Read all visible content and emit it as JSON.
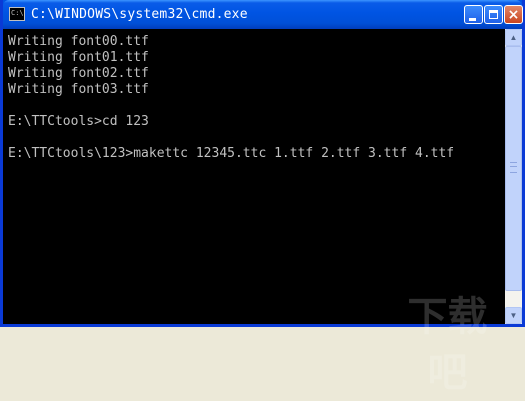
{
  "window": {
    "title": "C:\\WINDOWS\\system32\\cmd.exe",
    "icon": "console-icon",
    "icon_text": "C:\\"
  },
  "console": {
    "lines": [
      "Writing font00.ttf",
      "Writing font01.ttf",
      "Writing font02.ttf",
      "Writing font03.ttf",
      "",
      "E:\\TTCtools>cd 123",
      "",
      "E:\\TTCtools\\123>makettc 12345.ttc 1.ttf 2.ttf 3.ttf 4.ttf"
    ]
  },
  "controls": {
    "minimize_icon": "minimize-icon",
    "maximize_icon": "maximize-icon",
    "close_icon": "close-icon",
    "close_glyph": "×"
  },
  "scrollbar": {
    "up_glyph": "▲",
    "down_glyph": "▼",
    "position": 0
  },
  "watermark": {
    "text": "下载吧"
  },
  "colors": {
    "console_bg": "#000000",
    "console_fg": "#c0c0c0",
    "titlebar": "#0054e3"
  }
}
